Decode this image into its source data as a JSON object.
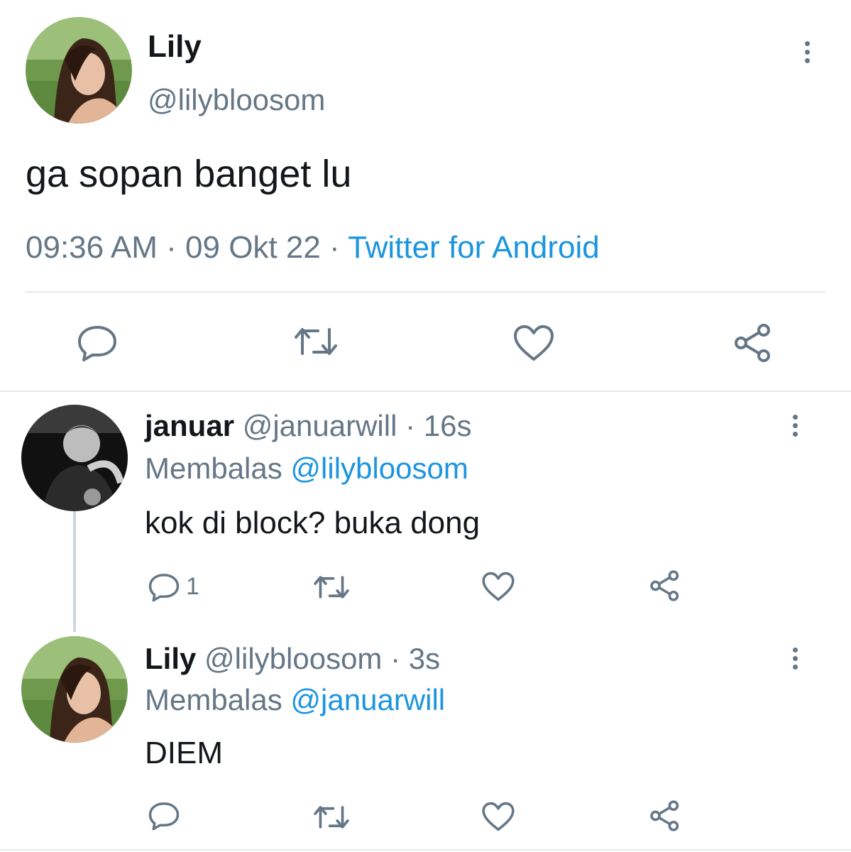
{
  "main_tweet": {
    "name": "Lily",
    "handle": "@lilybloosom",
    "text": "ga sopan banget lu",
    "time": "09:36 AM",
    "separator": "·",
    "date": "09 Okt 22",
    "source": "Twitter for Android"
  },
  "replies": [
    {
      "name": "januar",
      "handle": "@januarwill",
      "age": "16s",
      "replying_prefix": "Membalas",
      "replying_to": "@lilybloosom",
      "text": "kok di block? buka dong",
      "reply_count": "1"
    },
    {
      "name": "Lily",
      "handle": "@lilybloosom",
      "age": "3s",
      "replying_prefix": "Membalas",
      "replying_to": "@januarwill",
      "text": "DIEM"
    }
  ],
  "icons": {
    "reply": "reply-icon",
    "retweet": "retweet-icon",
    "like": "heart-icon",
    "share": "share-icon",
    "more": "more-vertical-icon"
  },
  "colors": {
    "text": "#14171a",
    "secondary": "#657786",
    "link": "#1b95e0",
    "divider": "#e1e8ed"
  }
}
